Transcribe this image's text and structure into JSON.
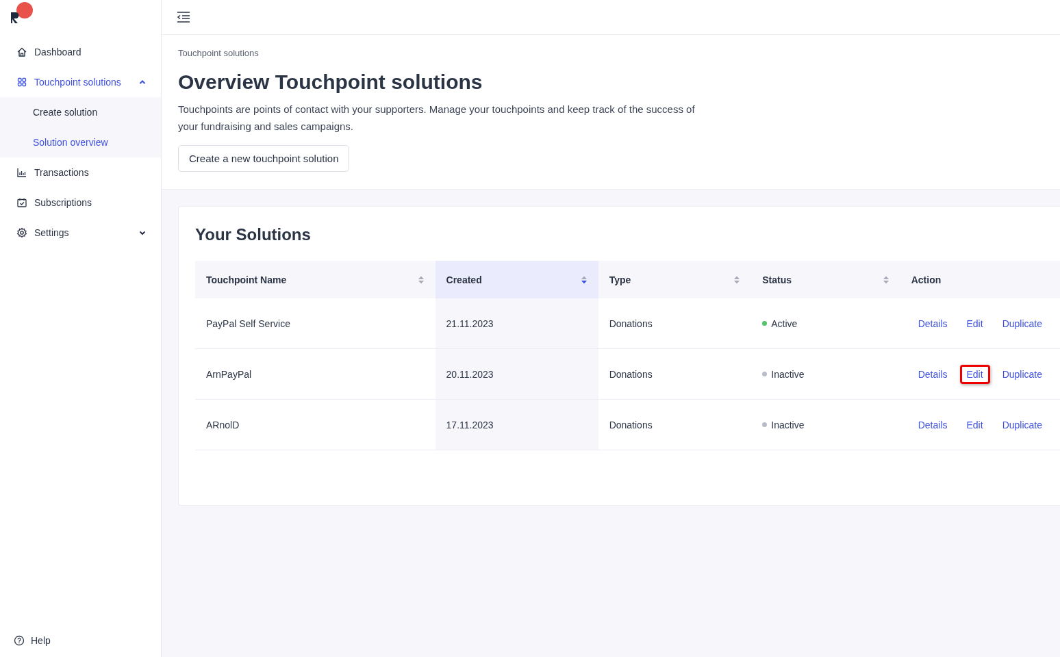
{
  "sidebar": {
    "items": [
      {
        "kind": "home",
        "label": "Dashboard",
        "selected": false
      },
      {
        "kind": "grid",
        "label": "Touchpoint solutions",
        "selected": true,
        "expanded": true,
        "children": [
          {
            "label": "Create solution",
            "selected": false
          },
          {
            "label": "Solution overview",
            "selected": true
          }
        ]
      },
      {
        "kind": "chart",
        "label": "Transactions",
        "selected": false
      },
      {
        "kind": "calendar",
        "label": "Subscriptions",
        "selected": false
      },
      {
        "kind": "gear",
        "label": "Settings",
        "selected": false,
        "expanded": false
      }
    ],
    "help": "Help"
  },
  "breadcrumb": "Touchpoint solutions",
  "title": "Overview Touchpoint solutions",
  "description": "Touchpoints are points of contact with your supporters. Manage your touchpoints and keep track of the success of your fundraising and sales campaigns.",
  "create_button": "Create a new touchpoint solution",
  "card": {
    "title": "Your Solutions",
    "table": {
      "columns": [
        {
          "label": "Touchpoint Name",
          "sortable": true,
          "sorted": false
        },
        {
          "label": "Created",
          "sortable": true,
          "sorted": true
        },
        {
          "label": "Type",
          "sortable": true,
          "sorted": false
        },
        {
          "label": "Status",
          "sortable": true,
          "sorted": false
        },
        {
          "label": "Action",
          "sortable": false,
          "sorted": false
        }
      ],
      "rows": [
        {
          "name": "PayPal Self Service",
          "created": "21.11.2023",
          "type": "Donations",
          "status": "Active",
          "color": "#52c46b",
          "actions": [
            {
              "label": "Details",
              "highlighted": false
            },
            {
              "label": "Edit",
              "highlighted": false
            },
            {
              "label": "Duplicate",
              "highlighted": false
            }
          ]
        },
        {
          "name": "ArnPayPal",
          "created": "20.11.2023",
          "type": "Donations",
          "status": "Inactive",
          "color": "#b9bcc8",
          "actions": [
            {
              "label": "Details",
              "highlighted": false
            },
            {
              "label": "Edit",
              "highlighted": true
            },
            {
              "label": "Duplicate",
              "highlighted": false
            }
          ]
        },
        {
          "name": "ARnolD",
          "created": "17.11.2023",
          "type": "Donations",
          "status": "Inactive",
          "color": "#b9bcc8",
          "actions": [
            {
              "label": "Details",
              "highlighted": false
            },
            {
              "label": "Edit",
              "highlighted": false
            },
            {
              "label": "Duplicate",
              "highlighted": false
            }
          ]
        }
      ]
    }
  }
}
